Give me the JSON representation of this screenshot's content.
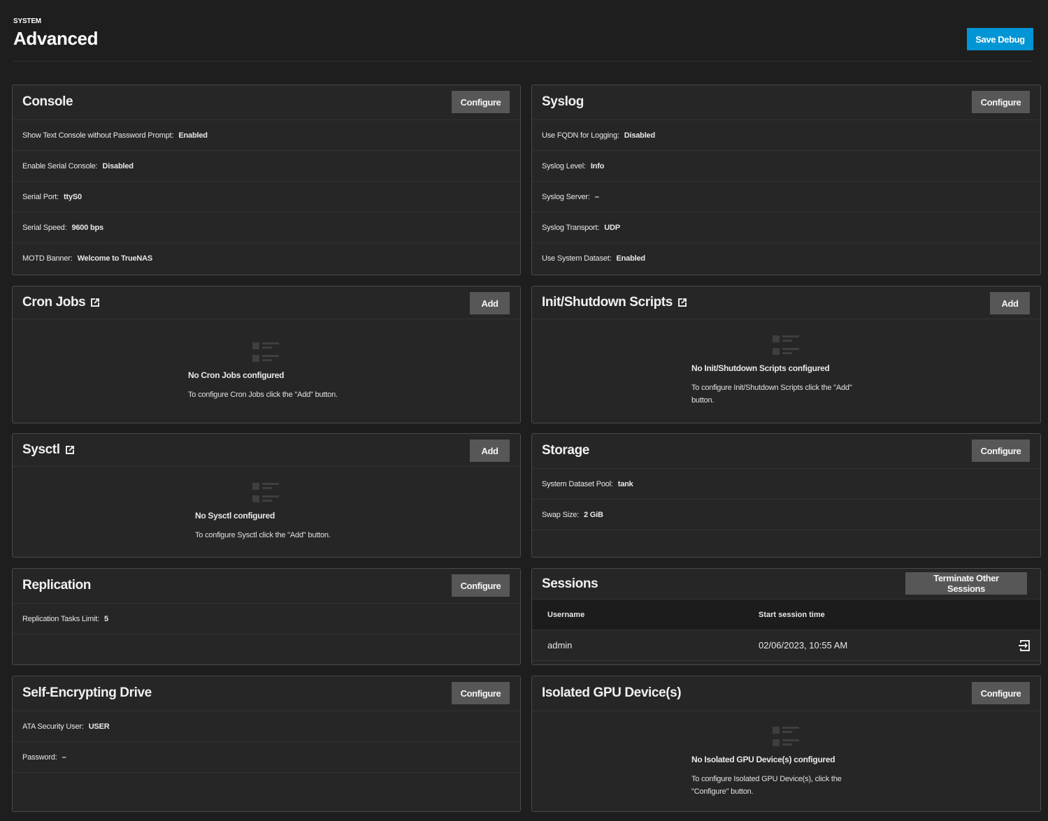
{
  "header": {
    "breadcrumb": "SYSTEM",
    "title": "Advanced",
    "save_debug_label": "Save Debug"
  },
  "console": {
    "title": "Console",
    "button": "Configure",
    "rows": [
      {
        "label": "Show Text Console without Password Prompt:",
        "value": "Enabled"
      },
      {
        "label": "Enable Serial Console:",
        "value": "Disabled"
      },
      {
        "label": "Serial Port:",
        "value": "ttyS0"
      },
      {
        "label": "Serial Speed:",
        "value": "9600 bps"
      },
      {
        "label": "MOTD Banner:",
        "value": "Welcome to TrueNAS"
      }
    ]
  },
  "syslog": {
    "title": "Syslog",
    "button": "Configure",
    "rows": [
      {
        "label": "Use FQDN for Logging:",
        "value": "Disabled"
      },
      {
        "label": "Syslog Level:",
        "value": "Info"
      },
      {
        "label": "Syslog Server:",
        "value": "–"
      },
      {
        "label": "Syslog Transport:",
        "value": "UDP"
      },
      {
        "label": "Use System Dataset:",
        "value": "Enabled"
      }
    ]
  },
  "cron": {
    "title": "Cron Jobs",
    "button": "Add",
    "empty_title": "No Cron Jobs configured",
    "empty_msg": "To configure Cron Jobs click the \"Add\" button."
  },
  "init": {
    "title": "Init/Shutdown Scripts",
    "button": "Add",
    "empty_title": "No Init/Shutdown Scripts configured",
    "empty_msg_1": "To configure Init/Shutdown Scripts click the \"Add\"",
    "empty_msg_2": "button."
  },
  "sysctl": {
    "title": "Sysctl",
    "button": "Add",
    "empty_title": "No Sysctl configured",
    "empty_msg": "To configure Sysctl click the \"Add\" button."
  },
  "storage": {
    "title": "Storage",
    "button": "Configure",
    "rows": [
      {
        "label": "System Dataset Pool:",
        "value": "tank"
      },
      {
        "label": "Swap Size:",
        "value": "2 GiB"
      }
    ]
  },
  "replication": {
    "title": "Replication",
    "button": "Configure",
    "rows": [
      {
        "label": "Replication Tasks Limit:",
        "value": "5"
      }
    ]
  },
  "sessions": {
    "title": "Sessions",
    "button": "Terminate Other Sessions",
    "col_username": "Username",
    "col_start": "Start session time",
    "rows": [
      {
        "username": "admin",
        "start": "02/06/2023, 10:55 AM"
      }
    ]
  },
  "sed": {
    "title": "Self-Encrypting Drive",
    "button": "Configure",
    "rows": [
      {
        "label": "ATA Security User:",
        "value": "USER"
      },
      {
        "label": "Password:",
        "value": "–"
      }
    ]
  },
  "gpu": {
    "title": "Isolated GPU Device(s)",
    "button": "Configure",
    "empty_title": "No Isolated GPU Device(s) configured",
    "empty_msg_1": "To configure Isolated GPU Device(s), click the",
    "empty_msg_2": "\"Configure\" button."
  },
  "icons": {
    "external": "open-in-new-icon",
    "empty": "empty-list-icon",
    "logout": "logout-icon"
  },
  "colors": {
    "primary": "#0095d5",
    "background": "#1e1e1e",
    "card": "#262626",
    "button": "#575757"
  }
}
